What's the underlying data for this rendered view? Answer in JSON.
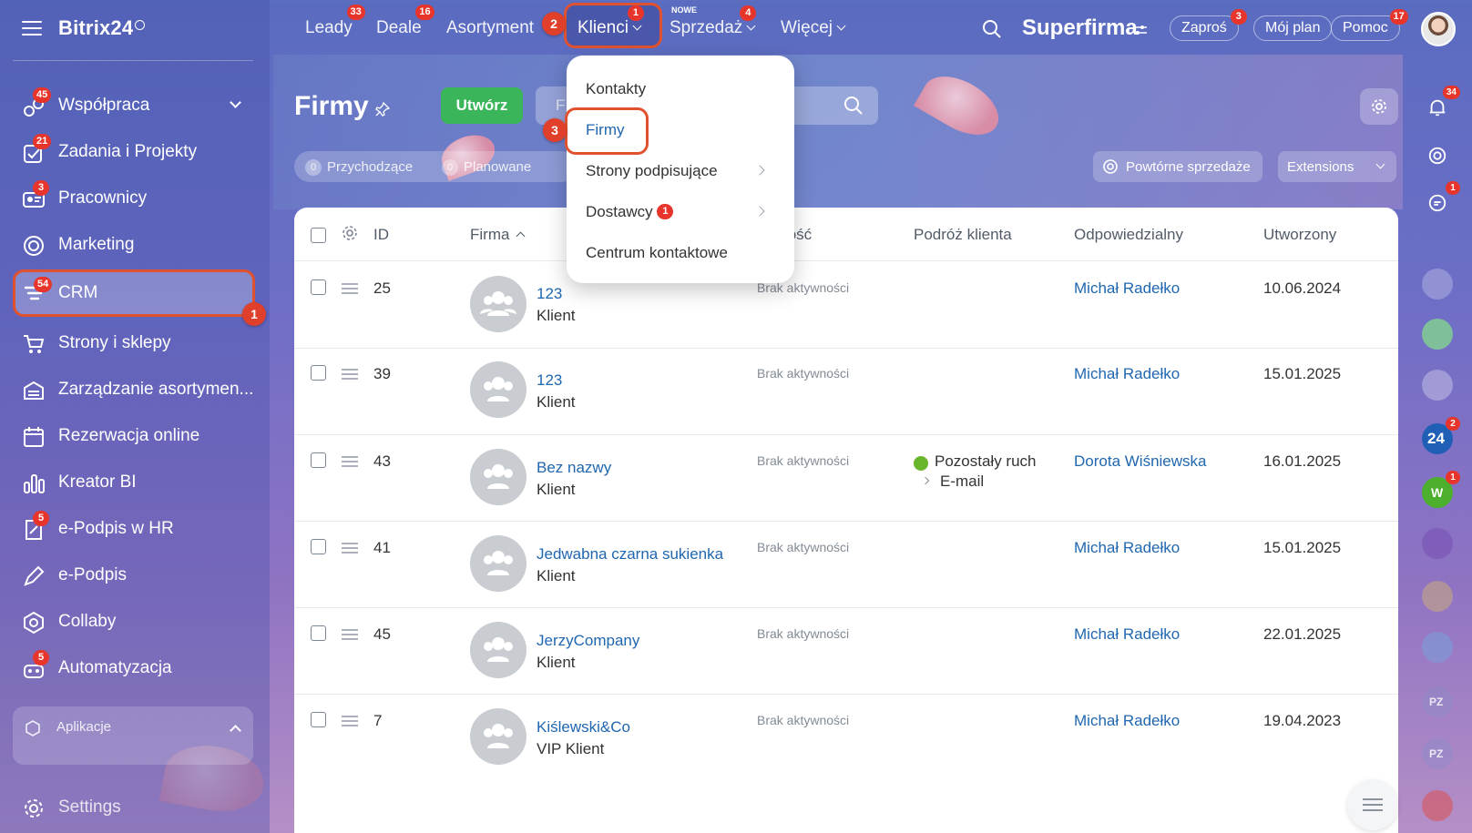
{
  "app": {
    "logo": "Bitrix24",
    "company": "Superfirma"
  },
  "sidebar": {
    "items": [
      {
        "label": "Współpraca",
        "badge": "45",
        "icon": "chat-bubbles-icon"
      },
      {
        "label": "Zadania i Projekty",
        "badge": "21",
        "icon": "checkbox-icon"
      },
      {
        "label": "Pracownicy",
        "badge": "3",
        "icon": "id-card-icon"
      },
      {
        "label": "Marketing",
        "badge": "",
        "icon": "target-icon"
      },
      {
        "label": "CRM",
        "badge": "54",
        "icon": "funnel-icon"
      },
      {
        "label": "Strony i sklepy",
        "badge": "",
        "icon": "cart-icon"
      },
      {
        "label": "Zarządzanie asortymen...",
        "badge": "",
        "icon": "warehouse-icon"
      },
      {
        "label": "Rezerwacja online",
        "badge": "",
        "icon": "calendar-icon"
      },
      {
        "label": "Kreator BI",
        "badge": "",
        "icon": "bar-chart-icon"
      },
      {
        "label": "e-Podpis w HR",
        "badge": "5",
        "icon": "doc-sign-icon"
      },
      {
        "label": "e-Podpis",
        "badge": "",
        "icon": "pen-icon"
      },
      {
        "label": "Collaby",
        "badge": "",
        "icon": "hexagon-icon"
      },
      {
        "label": "Automatyzacja",
        "badge": "5",
        "icon": "robot-icon"
      }
    ],
    "apps_label": "Aplikacje",
    "settings_label": "Settings"
  },
  "topnav": {
    "items": [
      {
        "label": "Leady",
        "badge": "33"
      },
      {
        "label": "Deale",
        "badge": "16"
      },
      {
        "label": "Asortyment",
        "badge": ""
      },
      {
        "label": "Klienci",
        "badge": "1"
      },
      {
        "label": "Sprzedaż",
        "badge": "4",
        "tag": "NOWE"
      },
      {
        "label": "Więcej",
        "badge": ""
      }
    ],
    "invite_label": "Zaproś",
    "invite_badge": "3",
    "plan_label": "Mój plan",
    "help_label": "Pomoc",
    "help_badge": "17"
  },
  "page": {
    "title": "Firmy",
    "create_label": "Utwórz",
    "search_placeholder": "F",
    "filters": [
      {
        "count": "0",
        "label": "Przychodzące"
      },
      {
        "count": "0",
        "label": "Planowane"
      }
    ],
    "repeat_sales_label": "Powtórne sprzedaże",
    "extensions_label": "Extensions"
  },
  "dropdown": {
    "items": [
      {
        "label": "Kontakty",
        "badge": "",
        "submenu": false
      },
      {
        "label": "Firmy",
        "badge": "",
        "submenu": false
      },
      {
        "label": "Strony podpisujące",
        "badge": "",
        "submenu": true
      },
      {
        "label": "Dostawcy",
        "badge": "1",
        "submenu": true
      },
      {
        "label": "Centrum kontaktowe",
        "badge": "",
        "submenu": false
      }
    ]
  },
  "table": {
    "columns": [
      "ID",
      "Firma",
      "wność",
      "Podróż klienta",
      "Odpowiedzialny",
      "Utworzony"
    ],
    "rows": [
      {
        "id": "25",
        "name": "123",
        "type": "Klient",
        "activity": "Brak aktywności",
        "journey": "",
        "journey_sub": "",
        "owner": "Michał Radełko",
        "created": "10.06.2024"
      },
      {
        "id": "39",
        "name": "123",
        "type": "Klient",
        "activity": "Brak aktywności",
        "journey": "",
        "journey_sub": "",
        "owner": "Michał Radełko",
        "created": "15.01.2025"
      },
      {
        "id": "43",
        "name": "Bez nazwy",
        "type": "Klient",
        "activity": "Brak aktywności",
        "journey": "Pozostały ruch",
        "journey_sub": "E-mail",
        "owner": "Dorota Wiśniewska",
        "created": "16.01.2025"
      },
      {
        "id": "41",
        "name": "Jedwabna czarna sukienka",
        "type": "Klient",
        "activity": "Brak aktywności",
        "journey": "",
        "journey_sub": "",
        "owner": "Michał Radełko",
        "created": "15.01.2025"
      },
      {
        "id": "45",
        "name": "JerzyCompany",
        "type": "Klient",
        "activity": "Brak aktywności",
        "journey": "",
        "journey_sub": "",
        "owner": "Michał Radełko",
        "created": "22.01.2025"
      },
      {
        "id": "7",
        "name": "Kiślewski&Co",
        "type": "VIP Klient",
        "activity": "Brak aktywności",
        "journey": "",
        "journey_sub": "",
        "owner": "Michał Radełko",
        "created": "19.04.2023"
      }
    ]
  },
  "annotations": {
    "step1": "1",
    "step2": "2",
    "step3": "3"
  },
  "rail": {
    "notif_badge": "34",
    "chat_badge": "1",
    "b24_badge": "2",
    "w_badge": "1",
    "b24_label": "24",
    "w_label": "W",
    "pz_label": "PZ"
  },
  "colors": {
    "accent": "#2067b0",
    "create": "#3bb55a",
    "badge": "#e8352b",
    "highlight": "#e0522f"
  }
}
